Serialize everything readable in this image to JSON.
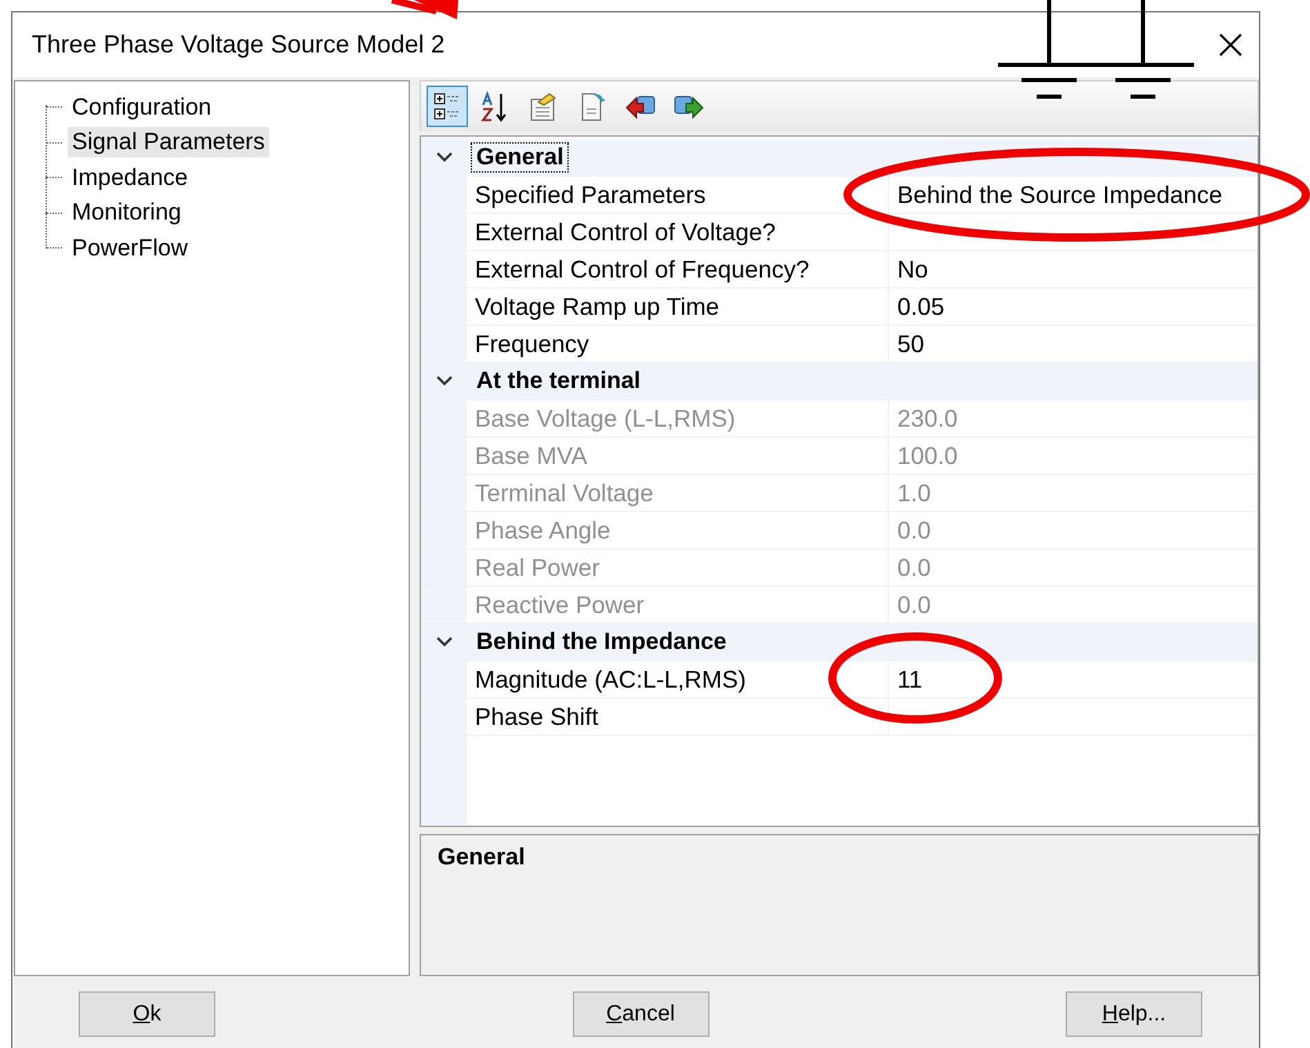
{
  "window": {
    "title": "Three Phase Voltage Source Model 2"
  },
  "tree": {
    "items": [
      {
        "label": "Configuration",
        "selected": false
      },
      {
        "label": "Signal Parameters",
        "selected": true
      },
      {
        "label": "Impedance",
        "selected": false
      },
      {
        "label": "Monitoring",
        "selected": false
      },
      {
        "label": "PowerFlow",
        "selected": false
      }
    ]
  },
  "toolbar": {
    "buttons": [
      {
        "kind": "categorized",
        "selected": true
      },
      {
        "kind": "alphabetical",
        "selected": false
      },
      {
        "kind": "properties",
        "selected": false
      },
      {
        "kind": "pages",
        "selected": false
      },
      {
        "kind": "back",
        "selected": false
      },
      {
        "kind": "forward",
        "selected": false
      }
    ]
  },
  "grid": {
    "categories": [
      {
        "label": "General",
        "expanded": true,
        "focused": true,
        "rows": [
          {
            "name": "Specified Parameters",
            "value": "Behind the Source Impedance",
            "disabled": false
          },
          {
            "name": "External Control of Voltage?",
            "disabled": false
          },
          {
            "name": "External Control of Frequency?",
            "value": "No",
            "disabled": false
          },
          {
            "name": "Voltage Ramp up Time",
            "value": "0.05",
            "disabled": false
          },
          {
            "name": "Frequency",
            "value": "50",
            "disabled": false
          }
        ]
      },
      {
        "label": "At the terminal",
        "expanded": true,
        "focused": false,
        "rows": [
          {
            "name": "Base Voltage (L-L,RMS)",
            "value": "230.0",
            "disabled": true
          },
          {
            "name": "Base MVA",
            "value": "100.0",
            "disabled": true
          },
          {
            "name": "Terminal Voltage",
            "value": "1.0",
            "disabled": true
          },
          {
            "name": "Phase Angle",
            "value": "0.0",
            "disabled": true
          },
          {
            "name": "Real Power",
            "value": "0.0",
            "disabled": true
          },
          {
            "name": "Reactive Power",
            "value": "0.0",
            "disabled": true
          }
        ]
      },
      {
        "label": "Behind the Impedance",
        "expanded": true,
        "focused": false,
        "rows": [
          {
            "name": "Magnitude (AC:L-L,RMS)",
            "value": "11",
            "disabled": false
          },
          {
            "name": "Phase Shift",
            "disabled": false
          }
        ]
      }
    ]
  },
  "description": {
    "title": "General"
  },
  "buttons": [
    {
      "label": "Ok",
      "underline_first": true
    },
    {
      "label": "Cancel",
      "underline_first": true
    },
    {
      "label": "Help...",
      "underline_first": true
    }
  ]
}
